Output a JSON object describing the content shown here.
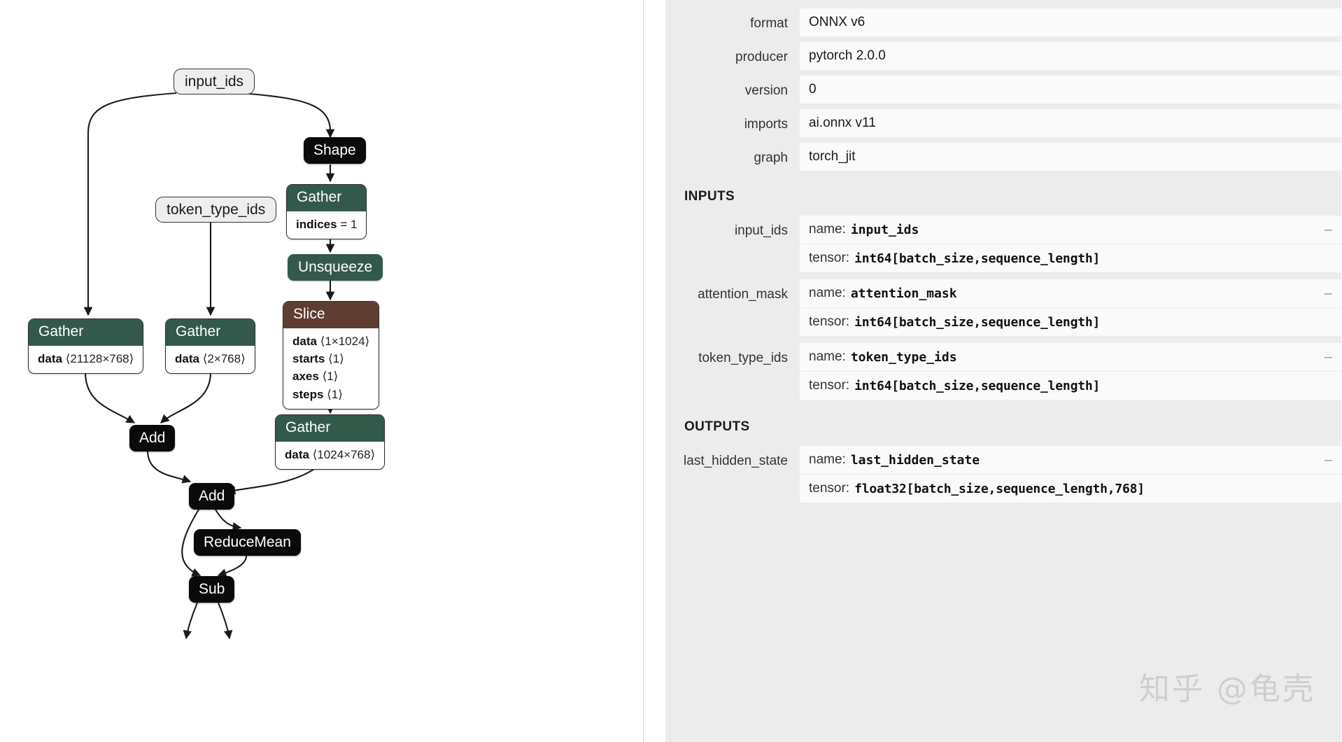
{
  "graph": {
    "nodes": [
      {
        "id": "input_ids",
        "kind": "io",
        "label": "input_ids"
      },
      {
        "id": "token_type_ids",
        "kind": "io",
        "label": "token_type_ids"
      },
      {
        "id": "shape",
        "kind": "op",
        "label": "Shape"
      },
      {
        "id": "gather_shape",
        "kind": "green",
        "label": "Gather",
        "attrs": [
          {
            "key": "indices",
            "sep": " = ",
            "value": "1"
          }
        ]
      },
      {
        "id": "unsqueeze",
        "kind": "solid",
        "label": "Unsqueeze"
      },
      {
        "id": "slice",
        "kind": "brown",
        "label": "Slice",
        "attrs": [
          {
            "key": "data",
            "sep": " ",
            "value": "⟨1×1024⟩"
          },
          {
            "key": "starts",
            "sep": " ",
            "value": "⟨1⟩"
          },
          {
            "key": "axes",
            "sep": " ",
            "value": "⟨1⟩"
          },
          {
            "key": "steps",
            "sep": " ",
            "value": "⟨1⟩"
          }
        ]
      },
      {
        "id": "gather_word",
        "kind": "green",
        "label": "Gather",
        "attrs": [
          {
            "key": "data",
            "sep": " ",
            "value": "⟨21128×768⟩"
          }
        ]
      },
      {
        "id": "gather_token",
        "kind": "green",
        "label": "Gather",
        "attrs": [
          {
            "key": "data",
            "sep": " ",
            "value": "⟨2×768⟩"
          }
        ]
      },
      {
        "id": "gather_pos",
        "kind": "green",
        "label": "Gather",
        "attrs": [
          {
            "key": "data",
            "sep": " ",
            "value": "⟨1024×768⟩"
          }
        ]
      },
      {
        "id": "add1",
        "kind": "op",
        "label": "Add"
      },
      {
        "id": "add2",
        "kind": "op",
        "label": "Add"
      },
      {
        "id": "reducemean",
        "kind": "op",
        "label": "ReduceMean"
      },
      {
        "id": "sub",
        "kind": "op",
        "label": "Sub"
      }
    ],
    "colors": {
      "op_fill": "#0a0a0a",
      "green_header": "#33594b",
      "brown_header": "#5e3d33",
      "io_fill": "#eeeeee",
      "edge": "#1a1a1a"
    }
  },
  "sidebar": {
    "properties": [
      {
        "label": "format",
        "value": "ONNX v6"
      },
      {
        "label": "producer",
        "value": "pytorch 2.0.0"
      },
      {
        "label": "version",
        "value": "0"
      },
      {
        "label": "imports",
        "value": "ai.onnx v11"
      },
      {
        "label": "graph",
        "value": "torch_jit"
      }
    ],
    "inputs_title": "INPUTS",
    "outputs_title": "OUTPUTS",
    "name_label": "name:",
    "tensor_label": "tensor:",
    "collapse_glyph": "–",
    "inputs": [
      {
        "label": "input_ids",
        "name": "input_ids",
        "tensor": "int64[batch_size,sequence_length]"
      },
      {
        "label": "attention_mask",
        "name": "attention_mask",
        "tensor": "int64[batch_size,sequence_length]"
      },
      {
        "label": "token_type_ids",
        "name": "token_type_ids",
        "tensor": "int64[batch_size,sequence_length]"
      }
    ],
    "outputs": [
      {
        "label": "last_hidden_state",
        "name": "last_hidden_state",
        "tensor": "float32[batch_size,sequence_length,768]"
      }
    ]
  },
  "watermark": {
    "text": "知乎 @龟壳"
  }
}
